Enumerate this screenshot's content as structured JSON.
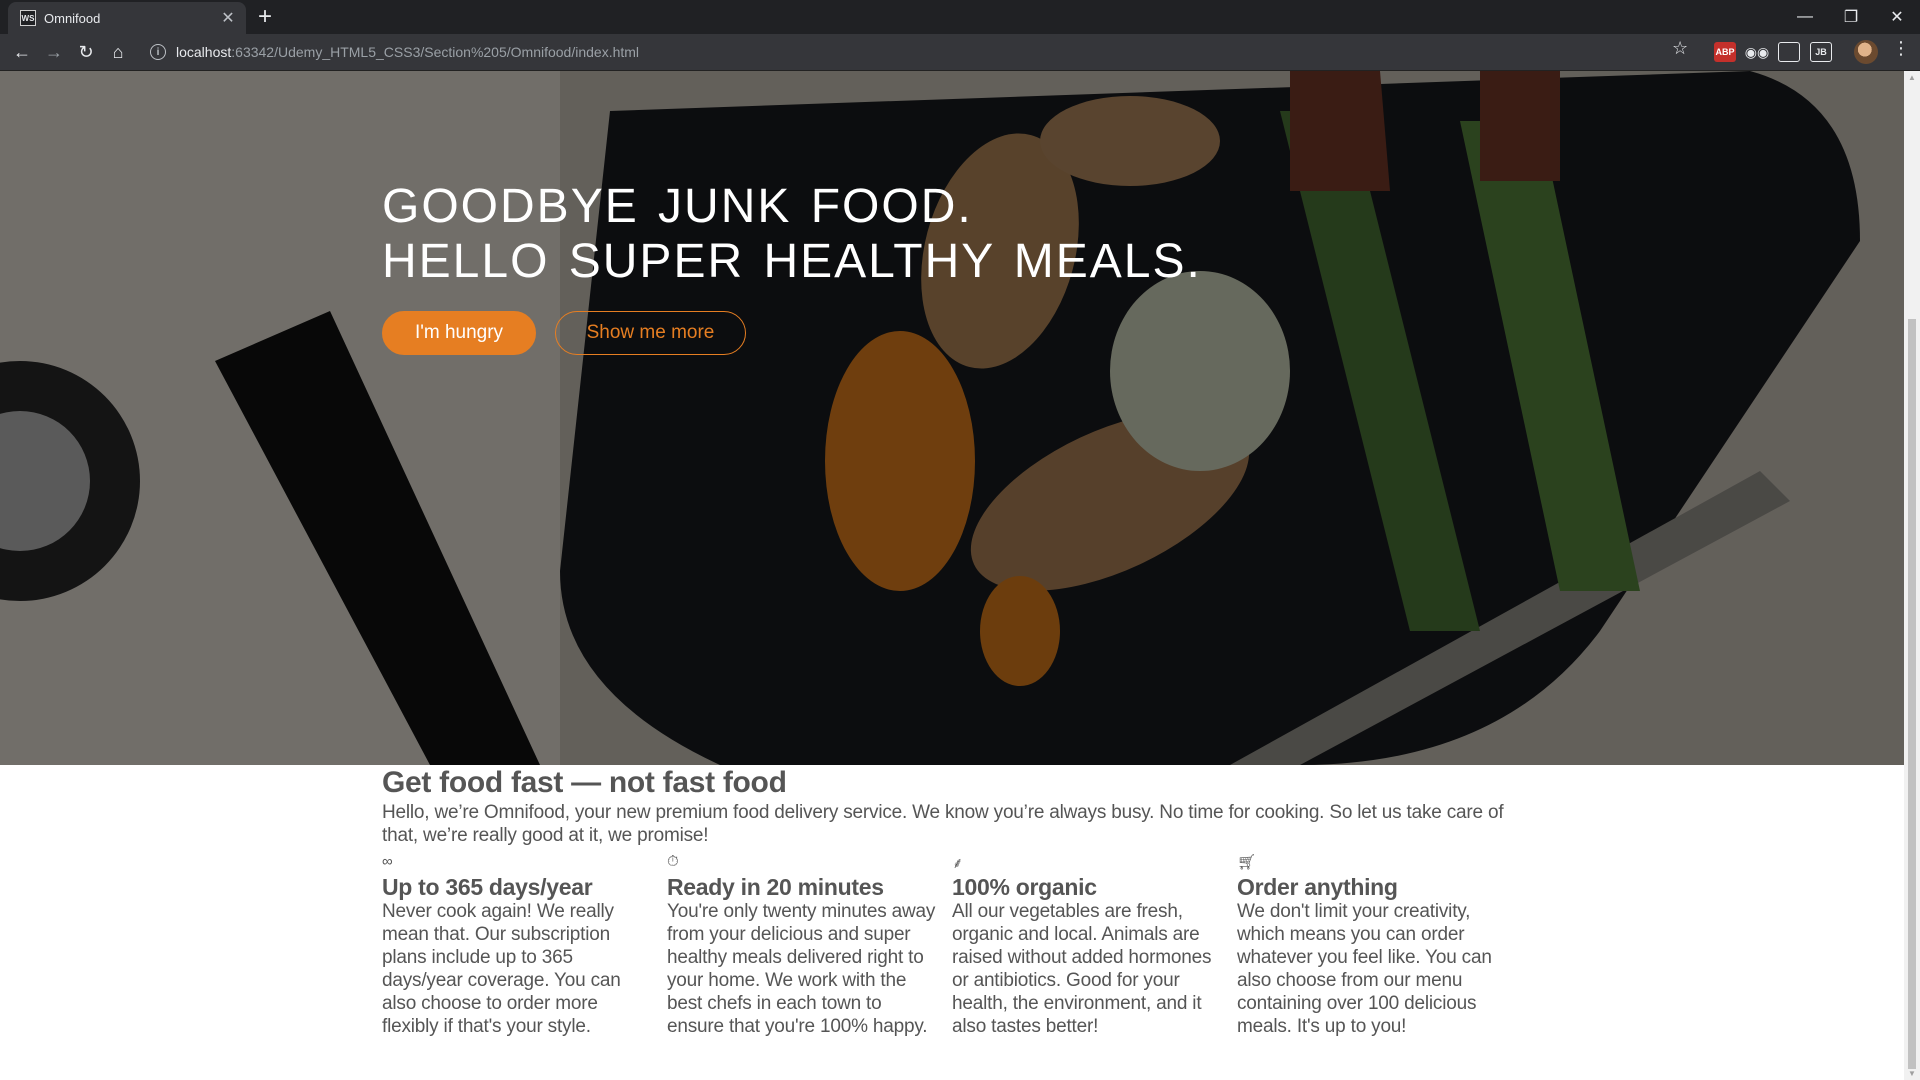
{
  "browser": {
    "tab_title": "Omnifood",
    "tab_favicon_text": "WS",
    "url_host": "localhost",
    "url_rest": ":63342/Udemy_HTML5_CSS3/Section%205/Omnifood/index.html",
    "extensions": [
      "ABP",
      "JB"
    ]
  },
  "hero": {
    "heading_line1": "Goodbye junk food.",
    "heading_line2": "Hello super healthy meals.",
    "btn_hungry": "I'm hungry",
    "btn_more": "Show me more"
  },
  "features": {
    "title": "Get food fast — not fast food",
    "intro": "Hello, we’re Omnifood, your new premium food delivery service. We know you’re always busy. No time for cooking. So let us take care of that, we’re really good at it, we promise!",
    "items": [
      {
        "icon": "infinity-icon",
        "title": "Up to 365 days/year",
        "text": "Never cook again! We really mean that. Our subscription plans include up to 365 days/year coverage. You can also choose to order more flexibly if that's your style."
      },
      {
        "icon": "stopwatch-icon",
        "title": "Ready in 20 minutes",
        "text": "You're only twenty minutes away from your delicious and super healthy meals delivered right to your home. We work with the best chefs in each town to ensure that you're 100% happy."
      },
      {
        "icon": "leaf-icon",
        "title": "100% organic",
        "text": "All our vegetables are fresh, organic and local. Animals are raised without added hormones or antibiotics. Good for your health, the environment, and it also tastes better!"
      },
      {
        "icon": "cart-icon",
        "title": "Order anything",
        "text": "We don't limit your creativity, which means you can order whatever you feel like. You can also choose from our menu containing over 100 delicious meals. It's up to you!"
      }
    ]
  },
  "colors": {
    "accent": "#e67e22",
    "text": "#555555",
    "chrome_dark": "#202124",
    "chrome_toolbar": "#35363a"
  }
}
